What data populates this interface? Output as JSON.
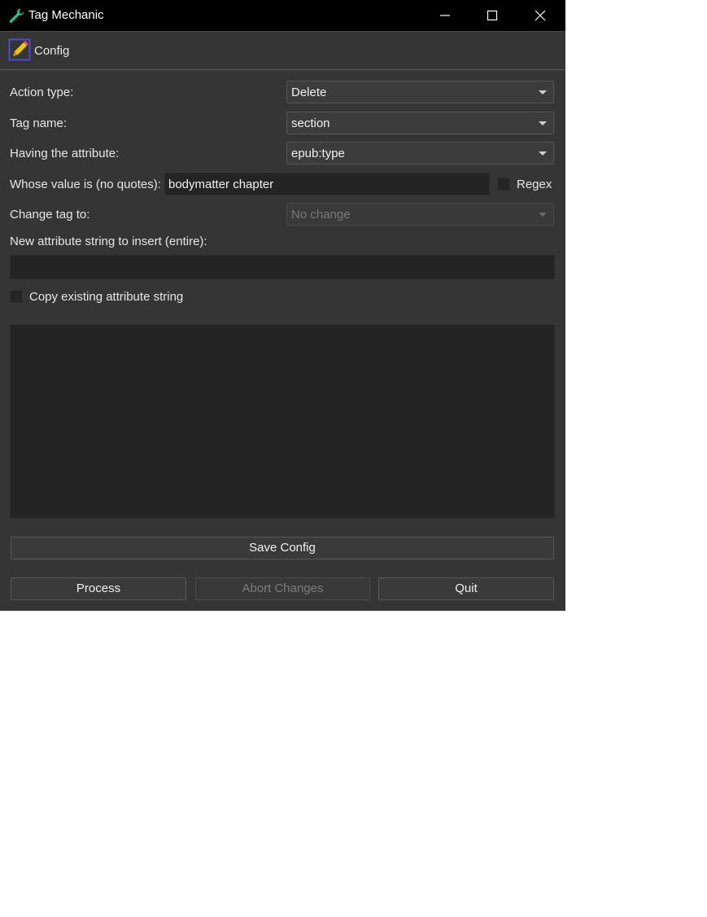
{
  "window": {
    "title": "Tag Mechanic",
    "controls": {
      "minimize": "minimize-icon",
      "maximize": "maximize-icon",
      "close": "close-icon"
    }
  },
  "toolbar": {
    "config_label": "Config"
  },
  "form": {
    "action_type": {
      "label": "Action type:",
      "value": "Delete"
    },
    "tag_name": {
      "label": "Tag name:",
      "value": "section"
    },
    "having_attribute": {
      "label": "Having the attribute:",
      "value": "epub:type"
    },
    "whose_value": {
      "label": "Whose value is (no quotes):",
      "value": "bodymatter chapter",
      "regex_label": "Regex",
      "regex_checked": false
    },
    "change_tag": {
      "label": "Change tag to:",
      "value": "No change",
      "disabled": true
    },
    "new_attr": {
      "label": "New attribute string to insert (entire):",
      "value": ""
    },
    "copy_existing": {
      "label": "Copy existing attribute string",
      "checked": false
    },
    "log_text": ""
  },
  "buttons": {
    "save_config": "Save Config",
    "process": "Process",
    "abort": "Abort Changes",
    "quit": "Quit"
  },
  "colors": {
    "background": "#353535",
    "titlebar": "#000000",
    "field": "#242424",
    "accent": "#4c4cd0"
  }
}
